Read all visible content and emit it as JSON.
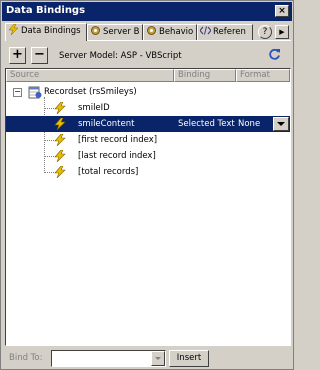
{
  "window": {
    "title": "Data Bindings",
    "close_glyph": "×"
  },
  "tabs": [
    {
      "label": "Data Bindings",
      "icon": "lightning-bolt-icon",
      "active": true
    },
    {
      "label": "Server B",
      "icon": "gear-icon",
      "active": false
    },
    {
      "label": "Behavio",
      "icon": "gear-icon",
      "active": false
    },
    {
      "label": "Referen",
      "icon": "code-brackets-icon",
      "active": false
    }
  ],
  "tab_controls": {
    "help_glyph": "?",
    "scroll_glyph": "▶"
  },
  "toolbar": {
    "add_glyph": "+",
    "remove_glyph": "−",
    "server_model": "Server Model: ASP - VBScript",
    "refresh_icon": "refresh-icon"
  },
  "grid": {
    "columns": [
      "Source",
      "Binding",
      "Format"
    ],
    "recordset": {
      "label": "Recordset (rsSmileys)",
      "expanded_glyph": "−",
      "icon": "database-icon"
    },
    "rows": [
      {
        "source": "smileID",
        "binding": "",
        "format": "",
        "selected": false
      },
      {
        "source": "smileContent",
        "binding": "Selected Text",
        "format": "None",
        "selected": true
      },
      {
        "source": "[first record index]",
        "binding": "",
        "format": "",
        "selected": false
      },
      {
        "source": "[last record index]",
        "binding": "",
        "format": "",
        "selected": false
      },
      {
        "source": "[total records]",
        "binding": "",
        "format": "",
        "selected": false
      }
    ]
  },
  "bottom": {
    "bind_label": "Bind To:",
    "bind_value": "",
    "insert_label": "Insert"
  },
  "colors": {
    "titlebar": "#0a246a",
    "selection": "#0a246a",
    "panel": "#d4d0c8",
    "bolt": "#e8c000"
  }
}
